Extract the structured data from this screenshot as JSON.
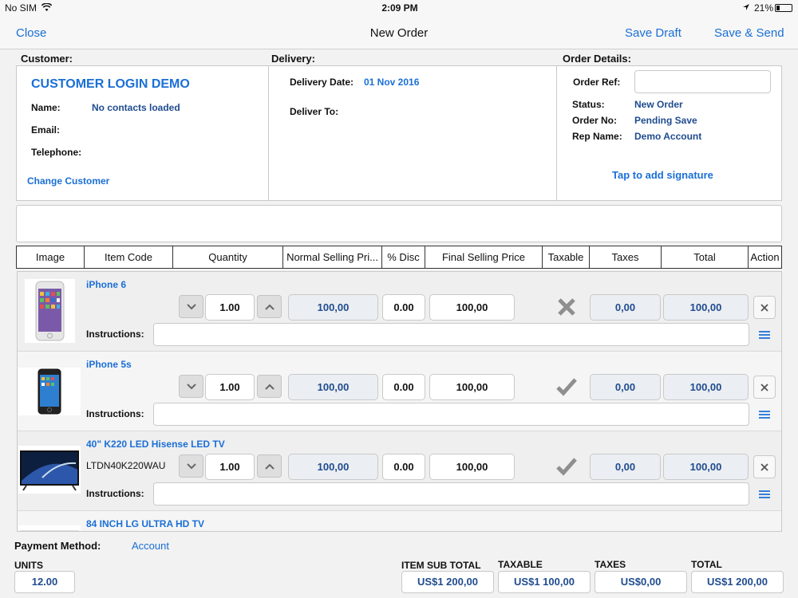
{
  "status_bar": {
    "carrier": "No SIM",
    "time": "2:09 PM",
    "battery": "21%"
  },
  "nav": {
    "close": "Close",
    "title": "New Order",
    "save_draft": "Save Draft",
    "save_send": "Save & Send"
  },
  "sections": {
    "customer": "Customer:",
    "delivery": "Delivery:",
    "order_details": "Order Details:"
  },
  "customer": {
    "name_title": "CUSTOMER LOGIN DEMO",
    "name_label": "Name:",
    "name_value": "No contacts loaded",
    "email_label": "Email:",
    "telephone_label": "Telephone:",
    "change": "Change Customer"
  },
  "delivery": {
    "date_label": "Delivery Date:",
    "date_value": "01 Nov 2016",
    "deliver_to_label": "Deliver To:"
  },
  "order": {
    "ref_label": "Order Ref:",
    "ref_value": "",
    "status_label": "Status:",
    "status_value": "New Order",
    "order_no_label": "Order No:",
    "order_no_value": "Pending Save",
    "rep_label": "Rep Name:",
    "rep_value": "Demo Account",
    "signature": "Tap to add signature"
  },
  "table": {
    "headers": [
      "Image",
      "Item Code",
      "Quantity",
      "Normal Selling Pri...",
      "% Disc",
      "Final Selling Price",
      "Taxable",
      "Taxes",
      "Total",
      "Action"
    ]
  },
  "items": [
    {
      "name": "iPhone 6",
      "code": "",
      "qty": "1.00",
      "normal_price": "100,00",
      "disc": "0.00",
      "final_price": "100,00",
      "taxable": "no",
      "taxes": "0,00",
      "total": "100,00",
      "instructions_label": "Instructions:"
    },
    {
      "name": "iPhone 5s",
      "code": "",
      "qty": "1.00",
      "normal_price": "100,00",
      "disc": "0.00",
      "final_price": "100,00",
      "taxable": "yes",
      "taxes": "0,00",
      "total": "100,00",
      "instructions_label": "Instructions:"
    },
    {
      "name": "40\" K220 LED Hisense LED TV",
      "code": "LTDN40K220WAU",
      "qty": "1.00",
      "normal_price": "100,00",
      "disc": "0.00",
      "final_price": "100,00",
      "taxable": "yes",
      "taxes": "0,00",
      "total": "100,00",
      "instructions_label": "Instructions:"
    },
    {
      "name": "84 INCH LG ULTRA HD TV"
    }
  ],
  "footer": {
    "payment_label": "Payment Method:",
    "payment_value": "Account",
    "units_label": "UNITS",
    "units_value": "12.00",
    "subtotal_label": "ITEM SUB TOTAL",
    "subtotal_value": "US$1 200,00",
    "taxable_label": "TAXABLE",
    "taxable_value": "US$1 100,00",
    "taxes_label": "TAXES",
    "taxes_value": "US$0,00",
    "total_label": "TOTAL",
    "total_value": "US$1 200,00"
  },
  "colors": {
    "accent": "#1a6fd6",
    "value_navy": "#1f4b8f",
    "background": "#f2f2f2"
  }
}
